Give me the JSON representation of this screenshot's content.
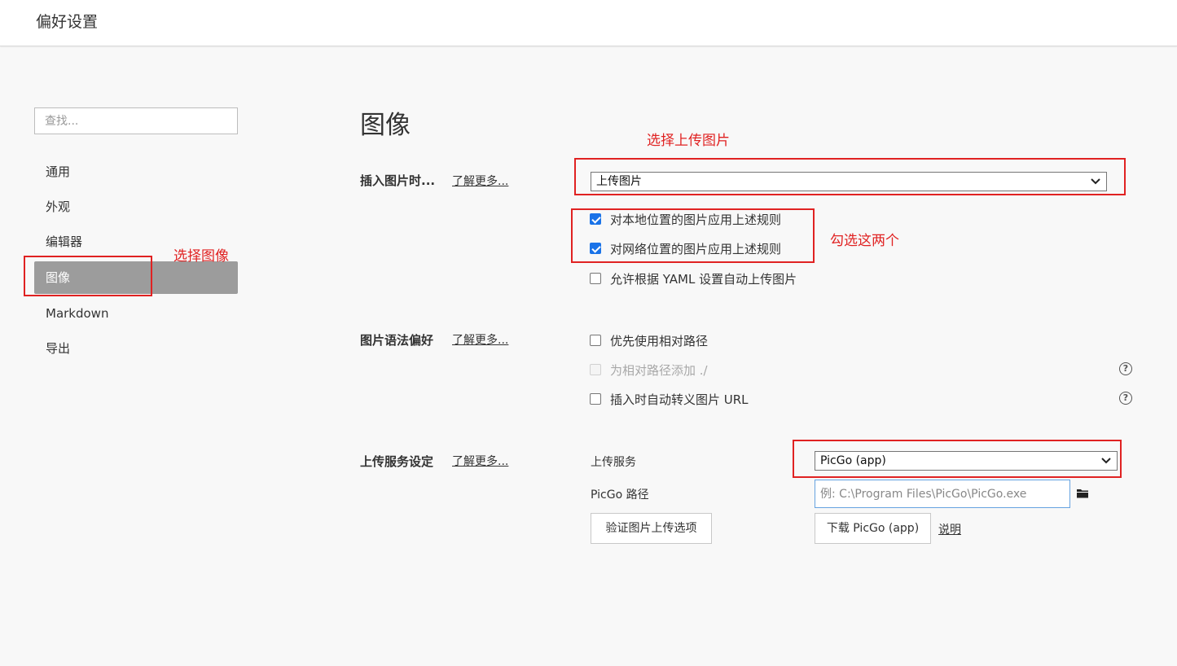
{
  "window": {
    "title": "偏好设置"
  },
  "sidebar": {
    "search_placeholder": "查找...",
    "items": [
      {
        "label": "通用"
      },
      {
        "label": "外观"
      },
      {
        "label": "编辑器"
      },
      {
        "label": "图像",
        "active": true
      },
      {
        "label": "Markdown"
      },
      {
        "label": "导出"
      }
    ]
  },
  "main": {
    "heading": "图像",
    "insert_section": {
      "label": "插入图片时...",
      "learn_more": "了解更多...",
      "select_value": "上传图片",
      "checkboxes": [
        {
          "label": "对本地位置的图片应用上述规则",
          "checked": true
        },
        {
          "label": "对网络位置的图片应用上述规则",
          "checked": true
        },
        {
          "label": "允许根据 YAML 设置自动上传图片",
          "checked": false
        }
      ]
    },
    "syntax_section": {
      "label": "图片语法偏好",
      "learn_more": "了解更多...",
      "checkboxes": [
        {
          "label": "优先使用相对路径",
          "checked": false
        },
        {
          "label": "为相对路径添加 ./",
          "checked": false,
          "disabled": true
        },
        {
          "label": "插入时自动转义图片 URL",
          "checked": false
        }
      ],
      "help_glyph": "?"
    },
    "upload_section": {
      "label": "上传服务设定",
      "learn_more": "了解更多...",
      "service_label": "上传服务",
      "service_value": "PicGo (app)",
      "path_label": "PicGo 路径",
      "path_placeholder": "例: C:\\Program Files\\PicGo\\PicGo.exe",
      "verify_button": "验证图片上传选项",
      "download_button": "下载 PicGo (app)",
      "explain_link": "说明"
    }
  },
  "annotations": {
    "select_upload": "选择上传图片",
    "check_both": "勾选这两个",
    "select_image": "选择图像",
    "color": "#e02222"
  },
  "accent_color": "#1a73e8"
}
